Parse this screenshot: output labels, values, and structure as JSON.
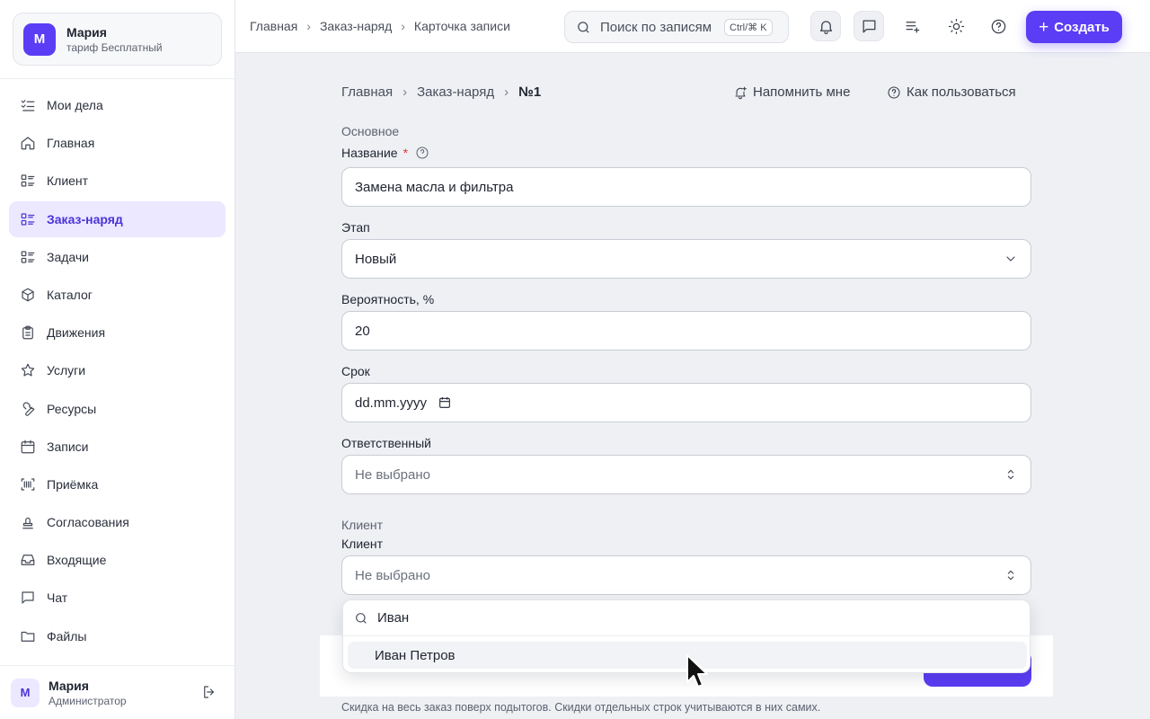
{
  "sidebar": {
    "org": {
      "avatar": "М",
      "name": "Мария",
      "plan": "тариф Бесплатный"
    },
    "items": [
      {
        "label": "Мои дела",
        "icon": "list-check-icon"
      },
      {
        "label": "Главная",
        "icon": "home-icon"
      },
      {
        "label": "Клиент",
        "icon": "list-grid-icon"
      },
      {
        "label": "Заказ-наряд",
        "icon": "list-grid-icon",
        "active": true
      },
      {
        "label": "Задачи",
        "icon": "list-grid-icon"
      },
      {
        "label": "Каталог",
        "icon": "box-icon"
      },
      {
        "label": "Движения",
        "icon": "clipboard-icon"
      },
      {
        "label": "Услуги",
        "icon": "star-icon"
      },
      {
        "label": "Ресурсы",
        "icon": "wrench-icon"
      },
      {
        "label": "Записи",
        "icon": "calendar-icon"
      },
      {
        "label": "Приёмка",
        "icon": "barcode-icon"
      },
      {
        "label": "Согласования",
        "icon": "stamp-icon"
      },
      {
        "label": "Входящие",
        "icon": "inbox-icon"
      },
      {
        "label": "Чат",
        "icon": "chat-icon"
      },
      {
        "label": "Файлы",
        "icon": "folder-icon"
      }
    ],
    "user": {
      "avatar": "М",
      "name": "Мария",
      "role": "Администратор"
    }
  },
  "topbar": {
    "breadcrumbs": [
      "Главная",
      "Заказ-наряд",
      "Карточка записи"
    ],
    "search_placeholder": "Поиск по записям",
    "search_shortcut": "Ctrl/⌘ K",
    "create_label": "Создать"
  },
  "main": {
    "breadcrumbs": [
      "Главная",
      "Заказ-наряд",
      "№1"
    ],
    "remind_label": "Напомнить мне",
    "howto_label": "Как пользоваться",
    "section_main": "Основное",
    "name_label": "Название",
    "name_required": "*",
    "name_value": "Замена масла и фильтра",
    "stage_label": "Этап",
    "stage_value": "Новый",
    "probability_label": "Вероятность, %",
    "probability_value": "20",
    "deadline_label": "Срок",
    "deadline_value": "dd.mm.yyyy",
    "responsible_label": "Ответственный",
    "responsible_value": "Не выбрано",
    "section_client": "Клиент",
    "client_label": "Клиент",
    "client_value": "Не выбрано",
    "dropdown": {
      "query": "Иван",
      "options": [
        "Иван Петров"
      ]
    },
    "discount_hint": "Скидка на весь заказ поверх подытогов. Скидки отдельных строк учитываются в них самих."
  },
  "colors": {
    "accent": "#5b3df5",
    "active_bg": "#ebe8ff",
    "required": "#e0342f"
  }
}
